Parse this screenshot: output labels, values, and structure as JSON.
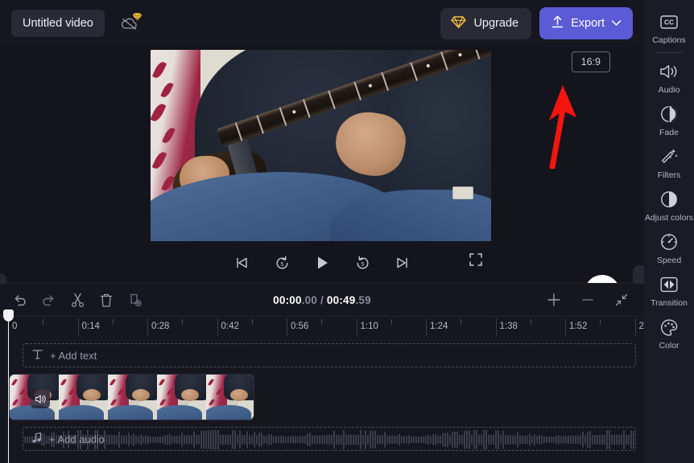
{
  "app": {
    "accent": "#5b5bd6",
    "bg": "#14141c",
    "panel_bg": "#16161f",
    "sidebar_bg": "#1b1b26",
    "gold": "#efbe3e"
  },
  "topbar": {
    "project_title": "Untitled video",
    "cloud_icon": "cloud-off-icon",
    "gem_icon": "gem-icon",
    "upgrade_label": "Upgrade",
    "export_label": "Export",
    "export_chevron": "chevron-down-icon"
  },
  "preview": {
    "aspect_ratio_label": "16:9",
    "help_label": "?",
    "collapse_left_chevron": "chevron-right-icon",
    "collapse_right_chevron": "chevron-left-icon",
    "panel_chevron": "chevron-down-icon",
    "annotation": "red-arrow-pointing-to-export",
    "controls": [
      {
        "name": "skip-to-start-button",
        "icon": "skip-previous-icon"
      },
      {
        "name": "rewind-5-button",
        "icon": "replay-5-icon",
        "label": "5"
      },
      {
        "name": "play-button",
        "icon": "play-icon"
      },
      {
        "name": "forward-5-button",
        "icon": "forward-5-icon",
        "label": "5"
      },
      {
        "name": "skip-to-end-button",
        "icon": "skip-next-icon"
      },
      {
        "name": "fullscreen-button",
        "icon": "fullscreen-icon"
      }
    ]
  },
  "timeline": {
    "tools": [
      {
        "name": "undo-button",
        "icon": "undo-icon"
      },
      {
        "name": "redo-button",
        "icon": "redo-icon"
      },
      {
        "name": "split-button",
        "icon": "scissors-icon"
      },
      {
        "name": "delete-button",
        "icon": "trash-icon"
      },
      {
        "name": "duplicate-button",
        "icon": "duplicate-icon"
      }
    ],
    "time_current": "00:00",
    "time_current_frames": ".00",
    "time_separator": " / ",
    "time_total": "00:49",
    "time_total_frames": ".59",
    "zoom_in": "plus-icon",
    "zoom_out": "minus-icon",
    "fit_icon": "fit-to-screen-icon",
    "ruler_labels": [
      "0",
      "0:14",
      "0:28",
      "0:42",
      "0:56",
      "1:10",
      "1:24",
      "1:38",
      "1:52",
      "2"
    ],
    "add_text_label": "+ Add text",
    "add_text_icon": "text-icon",
    "add_audio_label": "+ Add audio",
    "add_audio_icon": "music-note-icon",
    "clip_volume_icon": "volume-icon",
    "clip_thumb_count": 5
  },
  "sidebar": {
    "items": [
      {
        "label": "Captions",
        "icon": "captions-icon"
      },
      {
        "label": "Audio",
        "icon": "audio-icon"
      },
      {
        "label": "Fade",
        "icon": "fade-icon"
      },
      {
        "label": "Filters",
        "icon": "filters-icon"
      },
      {
        "label": "Adjust colors",
        "icon": "adjust-colors-icon"
      },
      {
        "label": "Speed",
        "icon": "speed-icon"
      },
      {
        "label": "Transition",
        "icon": "transition-icon"
      },
      {
        "label": "Color",
        "icon": "color-icon"
      }
    ]
  }
}
